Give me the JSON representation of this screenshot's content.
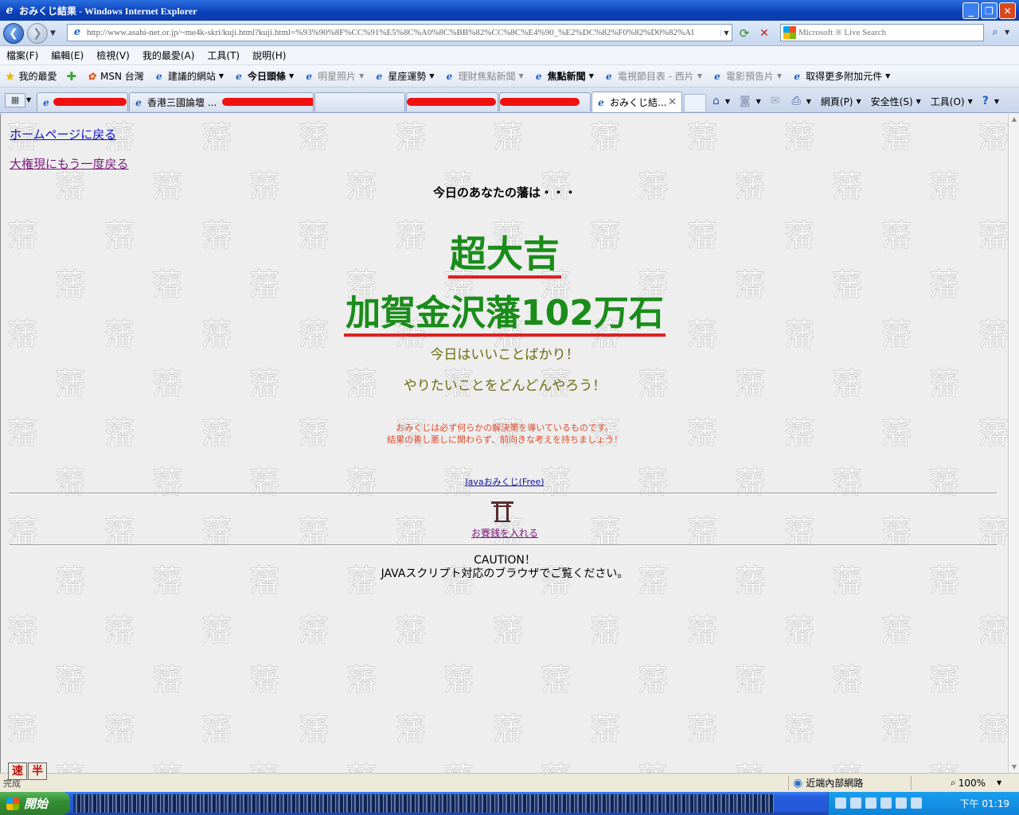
{
  "window": {
    "title": "おみくじ結果 - Windows Internet Explorer"
  },
  "address": {
    "url": "http://www.asahi-net.or.jp/~me4k-skri/kuji.html?kuji.html=%93%90%8F%CC%91%E5%8C%A0%8C%BB%82%CC%8C%E4%90_%E2%DC%82%F0%82%D0%82%AI",
    "search_placeholder": "Microsoft ® Live Search"
  },
  "menu": [
    "檔案(F)",
    "編輯(E)",
    "檢視(V)",
    "我的最愛(A)",
    "工具(T)",
    "說明(H)"
  ],
  "favorites": {
    "label": "我的最愛",
    "items": [
      {
        "label": "MSN 台灣",
        "dim": false,
        "bold": false,
        "caret": false
      },
      {
        "label": "建議的網站",
        "dim": false,
        "bold": false,
        "caret": true
      },
      {
        "label": "今日頭條",
        "dim": false,
        "bold": true,
        "caret": true
      },
      {
        "label": "明星照片",
        "dim": true,
        "bold": false,
        "caret": true
      },
      {
        "label": "星座運勢",
        "dim": false,
        "bold": false,
        "caret": true
      },
      {
        "label": "理財焦點新聞",
        "dim": true,
        "bold": false,
        "caret": true
      },
      {
        "label": "焦點新聞",
        "dim": false,
        "bold": true,
        "caret": true
      },
      {
        "label": "電視節目表 - 西片",
        "dim": true,
        "bold": false,
        "caret": true
      },
      {
        "label": "電影預告片",
        "dim": true,
        "bold": false,
        "caret": true
      },
      {
        "label": "取得更多附加元件",
        "dim": false,
        "bold": false,
        "caret": true
      }
    ]
  },
  "tabs": {
    "tab2": "香港三國論壇 ...",
    "active": "おみくじ結..."
  },
  "commands": {
    "page": "網頁(P)",
    "safety": "安全性(S)",
    "tools": "工具(O)"
  },
  "page": {
    "home_link": "ホームページに戻る",
    "back_link": "大権現にもう一度戻る",
    "intro": "今日のあなたの藩は・・・",
    "fortune": "超大吉",
    "domain": "加賀金沢藩102万石",
    "msg1": "今日はいいことばかり！",
    "msg2": "やりたいことをどんどんやろう！",
    "note1": "おみくじは必ず何らかの解決策を導いているものです。",
    "note2": "結果の善し悪しに関わらず、前向きな考えを持ちましょう！",
    "java_link": "Javaおみくじ(Free)",
    "saisen_link": "お賽銭を入れる",
    "caution1": "CAUTION！",
    "caution2": "JAVAスクリプト対応のブラウザでご覧ください。",
    "watermark_char": "藩"
  },
  "ime": [
    "速",
    "半"
  ],
  "status": {
    "text": "完成",
    "zone": "近端內部網路",
    "zoom": "100%"
  },
  "taskbar": {
    "start": "開始",
    "clock": "下午 01:19"
  },
  "colors": {
    "fortune_green": "#1a8c1a",
    "underline_red": "#e02020",
    "message_olive": "#6d6d10",
    "note_orange": "#e04a2a"
  }
}
